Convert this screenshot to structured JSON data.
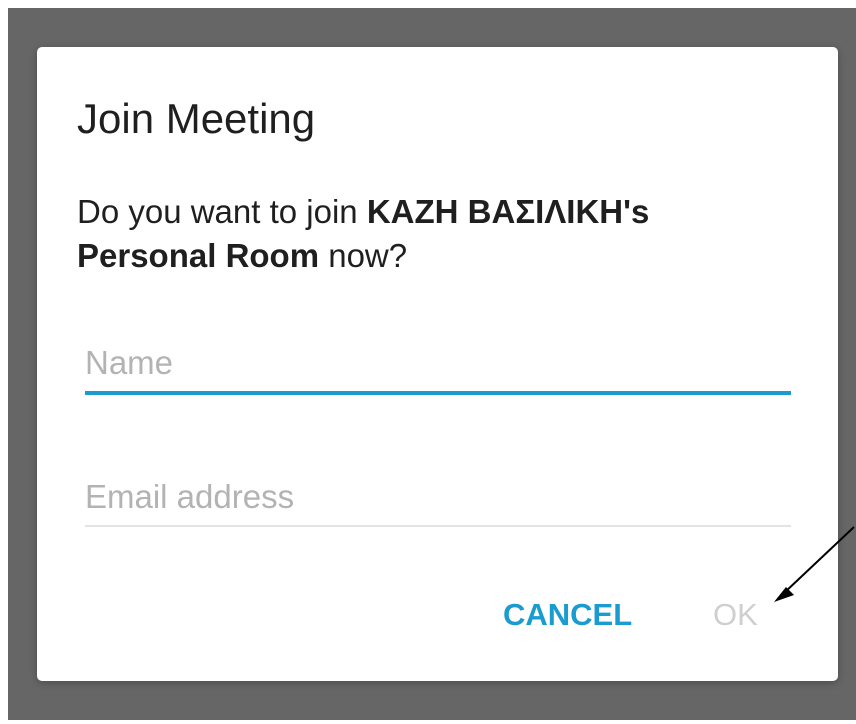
{
  "dialog": {
    "title": "Join Meeting",
    "message_prefix": "Do you want to join ",
    "message_room": "ΚΑΖΗ ΒΑΣΙΛΙΚΗ's Personal Room",
    "message_suffix": " now?",
    "name_field": {
      "placeholder": "Name",
      "value": ""
    },
    "email_field": {
      "placeholder": "Email address",
      "value": ""
    },
    "buttons": {
      "cancel_label": "CANCEL",
      "ok_label": "OK"
    }
  },
  "colors": {
    "accent": "#1a9cd0",
    "scrim": "#666666",
    "disabled": "#cfcfcf"
  }
}
